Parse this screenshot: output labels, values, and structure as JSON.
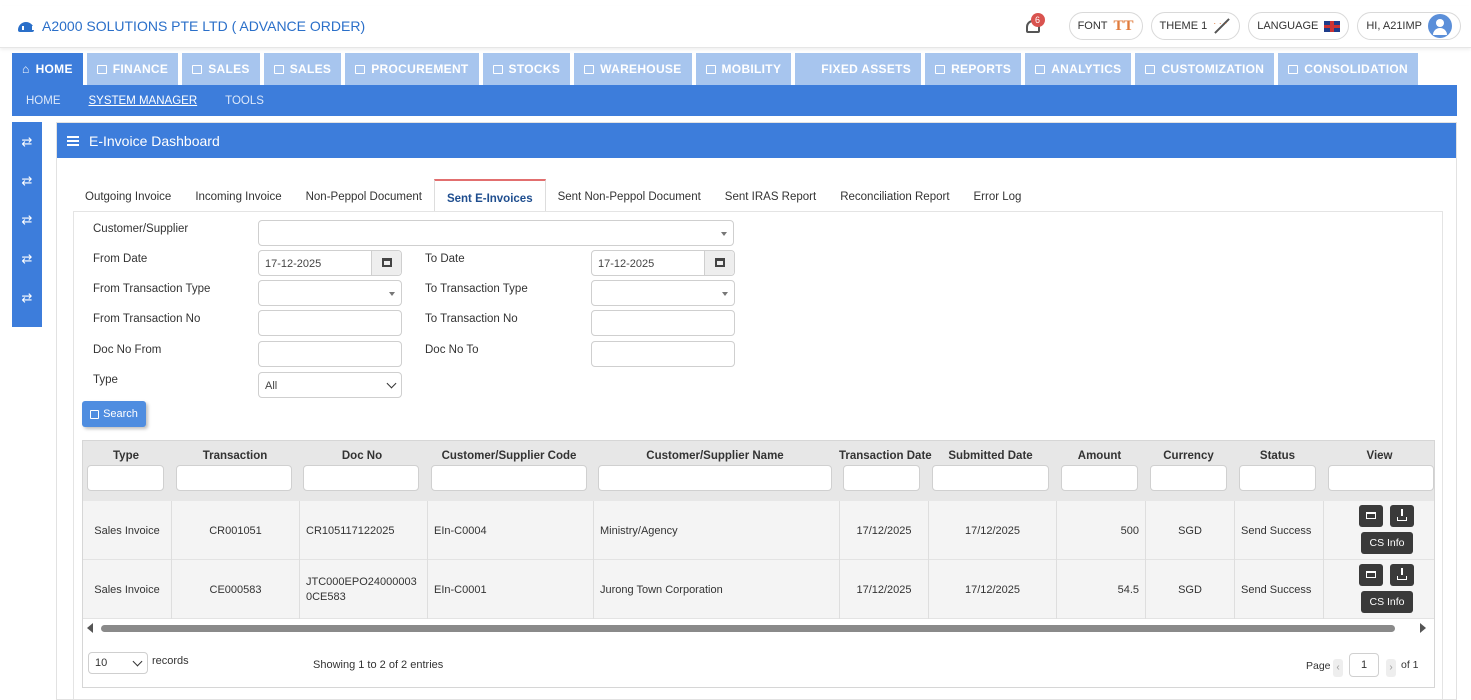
{
  "app": {
    "title": "A2000 SOLUTIONS PTE LTD ( ADVANCE ORDER)",
    "notification_count": "6",
    "font_label": "FONT",
    "font_icon_text": "TT",
    "theme_label": "THEME 1",
    "language_label": "LANGUAGE",
    "user_label": "HI, A21IMP"
  },
  "main_nav": [
    {
      "label": "HOME",
      "icon": "home-icon"
    },
    {
      "label": "FINANCE",
      "icon": "bank-icon"
    },
    {
      "label": "SALES",
      "icon": "users-icon"
    },
    {
      "label": "SALES",
      "icon": "cart-icon"
    },
    {
      "label": "PROCUREMENT",
      "icon": "bullhorn-icon"
    },
    {
      "label": "STOCKS",
      "icon": "bar-chart-icon"
    },
    {
      "label": "WAREHOUSE",
      "icon": "warehouse-icon"
    },
    {
      "label": "MOBILITY",
      "icon": "mobile-icon"
    },
    {
      "label": "FIXED ASSETS",
      "icon": ""
    },
    {
      "label": "REPORTS",
      "icon": "bar-chart-icon"
    },
    {
      "label": "ANALYTICS",
      "icon": "cart-icon"
    },
    {
      "label": "CUSTOMIZATION",
      "icon": "cart-icon"
    },
    {
      "label": "CONSOLIDATION",
      "icon": "cart-icon"
    }
  ],
  "sub_nav": {
    "home": "HOME",
    "system_manager": "SYSTEM MANAGER",
    "tools": "TOOLS"
  },
  "panel": {
    "title": "E-Invoice Dashboard"
  },
  "tabs": [
    "Outgoing Invoice",
    "Incoming Invoice",
    "Non-Peppol Document",
    "Sent E-Invoices",
    "Sent Non-Peppol Document",
    "Sent IRAS Report",
    "Reconciliation Report",
    "Error Log"
  ],
  "form": {
    "customer_supplier_label": "Customer/Supplier",
    "from_date_label": "From Date",
    "from_date_value": "17-12-2025",
    "to_date_label": "To Date",
    "to_date_value": "17-12-2025",
    "from_txn_type_label": "From Transaction Type",
    "to_txn_type_label": "To Transaction Type",
    "from_txn_no_label": "From Transaction No",
    "to_txn_no_label": "To Transaction No",
    "doc_no_from_label": "Doc No From",
    "doc_no_to_label": "Doc No To",
    "type_label": "Type",
    "type_value": "All",
    "search_label": "Search"
  },
  "table": {
    "columns": [
      "Type",
      "Transaction",
      "Doc No",
      "Customer/Supplier Code",
      "Customer/Supplier Name",
      "Transaction Date",
      "Submitted Date",
      "Amount",
      "Currency",
      "Status",
      "View"
    ],
    "rows": [
      {
        "type": "Sales Invoice",
        "transaction": "CR001051",
        "doc_no": "CR105117122025",
        "code": "EIn-C0004",
        "name": "Ministry/Agency",
        "txn_date": "17/12/2025",
        "sub_date": "17/12/2025",
        "amount": "500",
        "currency": "SGD",
        "status": "Send Success",
        "cs_label": "CS Info"
      },
      {
        "type": "Sales Invoice",
        "transaction": "CE000583",
        "doc_no": "JTC000EPO240000030CE583",
        "code": "EIn-C0001",
        "name": "Jurong Town Corporation",
        "txn_date": "17/12/2025",
        "sub_date": "17/12/2025",
        "amount": "54.5",
        "currency": "SGD",
        "status": "Send Success",
        "cs_label": "CS Info"
      }
    ]
  },
  "pager": {
    "page_size": "10",
    "records_label": "records",
    "showing": "Showing 1 to 2 of 2 entries",
    "page_label": "Page",
    "page_value": "1",
    "of_label": "of 1"
  }
}
